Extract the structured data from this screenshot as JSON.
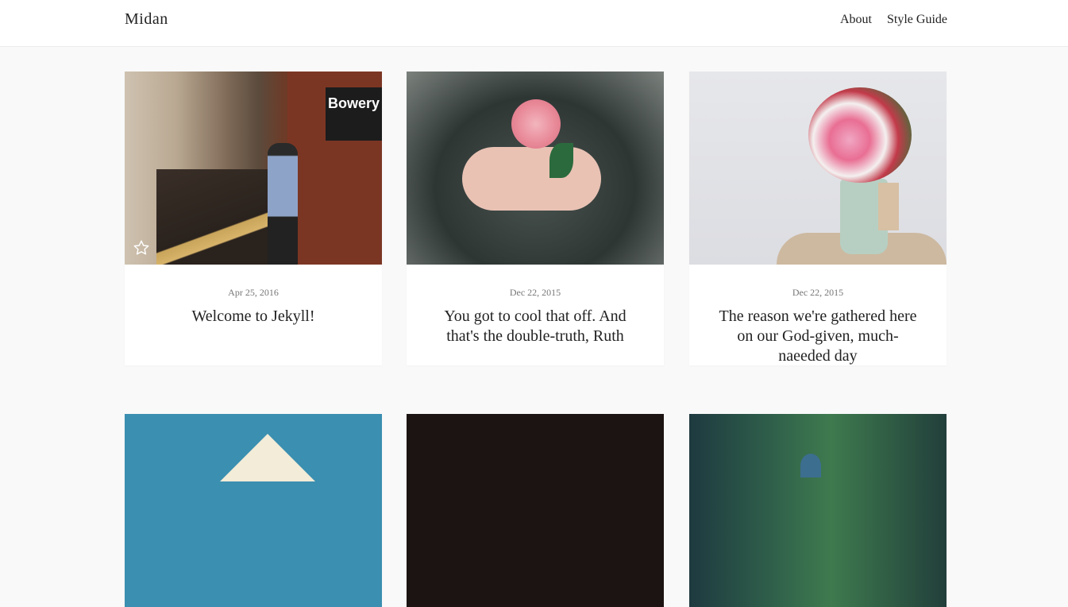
{
  "site": {
    "logo": "Midan"
  },
  "nav": {
    "items": [
      "About",
      "Style Guide"
    ]
  },
  "posts": [
    {
      "date": "Apr 25, 2016",
      "title": "Welcome to Jekyll!",
      "featured": true,
      "image_icon": "subway-platform-photo",
      "sign_text": "Bowery"
    },
    {
      "date": "Dec 22, 2015",
      "title": "You got to cool that off. And that's the double-truth, Ruth",
      "featured": false,
      "image_icon": "rose-in-hands-photo"
    },
    {
      "date": "Dec 22, 2015",
      "title": "The reason we're gathered here on our God-given, much-naeeded day",
      "featured": false,
      "image_icon": "flower-bouquet-photo"
    }
  ],
  "row2_images": [
    "building-sky-photo",
    "dark-photo",
    "forest-hiker-photo"
  ],
  "colors": {
    "background": "#f9f9f9",
    "card": "#ffffff",
    "text": "#222222",
    "date": "#777777"
  }
}
